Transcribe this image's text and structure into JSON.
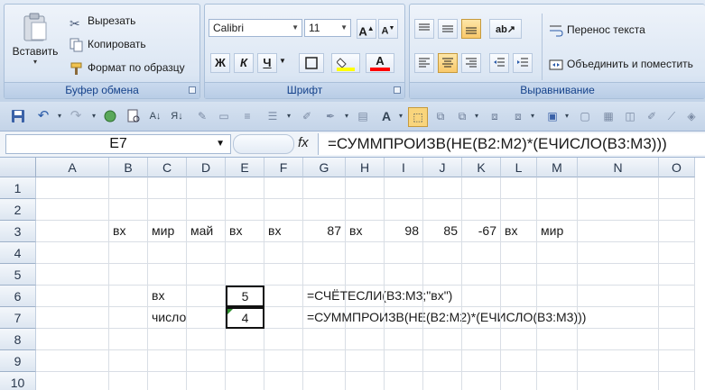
{
  "ribbon": {
    "clipboard": {
      "paste_label": "Вставить",
      "cut_label": "Вырезать",
      "copy_label": "Копировать",
      "format_painter_label": "Формат по образцу",
      "group_label": "Буфер обмена"
    },
    "font": {
      "font_name": "Calibri",
      "font_size": "11",
      "bold": "Ж",
      "italic": "К",
      "underline": "Ч",
      "group_label": "Шрифт",
      "highlight_color": "#ffff00",
      "font_color": "#ff0000"
    },
    "alignment": {
      "wrap_text_label": "Перенос текста",
      "merge_center_label": "Объединить и поместить",
      "group_label": "Выравнивание"
    }
  },
  "namebox": "E7",
  "formula": "=СУММПРОИЗВ(НЕ(B2:M2)*(ЕЧИСЛО(B3:M3)))",
  "columns": [
    "A",
    "B",
    "C",
    "D",
    "E",
    "F",
    "G",
    "H",
    "I",
    "J",
    "K",
    "L",
    "M",
    "N",
    "O"
  ],
  "rows": [
    "1",
    "2",
    "3",
    "4",
    "5",
    "6",
    "7",
    "8",
    "9",
    "10"
  ],
  "cells": {
    "B3": "вх",
    "C3": "мир",
    "D3": "май",
    "E3": "вх",
    "F3": "вх",
    "G3": "87",
    "H3": "вх",
    "I3": "98",
    "J3": "85",
    "K3": "-67",
    "L3": "вх",
    "M3": "мир",
    "C6": "вх",
    "E6": "5",
    "G6": "=СЧЁТЕСЛИ(B3:M3;\"вх\")",
    "C7": "число",
    "E7": "4",
    "G7": "=СУММПРОИЗВ(НЕ(B2:M2)*(ЕЧИСЛО(B3:M3)))"
  }
}
